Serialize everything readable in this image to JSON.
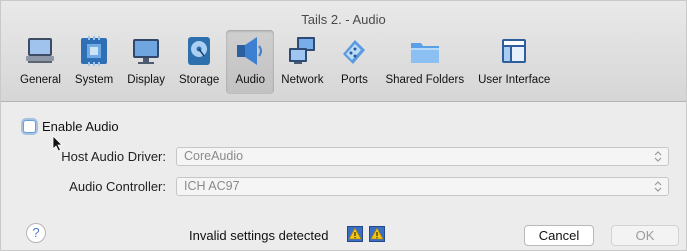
{
  "window": {
    "title": "Tails 2. - Audio"
  },
  "toolbar": {
    "items": [
      {
        "label": "General",
        "icon": "general-icon"
      },
      {
        "label": "System",
        "icon": "system-icon"
      },
      {
        "label": "Display",
        "icon": "display-icon"
      },
      {
        "label": "Storage",
        "icon": "storage-icon"
      },
      {
        "label": "Audio",
        "icon": "audio-icon",
        "active": true
      },
      {
        "label": "Network",
        "icon": "network-icon"
      },
      {
        "label": "Ports",
        "icon": "ports-icon"
      },
      {
        "label": "Shared Folders",
        "icon": "shared-folders-icon"
      },
      {
        "label": "User Interface",
        "icon": "user-interface-icon"
      }
    ]
  },
  "audio": {
    "enable_label": "Enable Audio",
    "enabled": false,
    "host_driver_label": "Host Audio Driver:",
    "host_driver_value": "CoreAudio",
    "controller_label": "Audio Controller:",
    "controller_value": "ICH AC97"
  },
  "footer": {
    "help_label": "?",
    "invalid_text": "Invalid settings detected",
    "cancel_label": "Cancel",
    "ok_label": "OK"
  },
  "colors": {
    "accent": "#6a9ed8",
    "window_bg": "#ececec"
  }
}
